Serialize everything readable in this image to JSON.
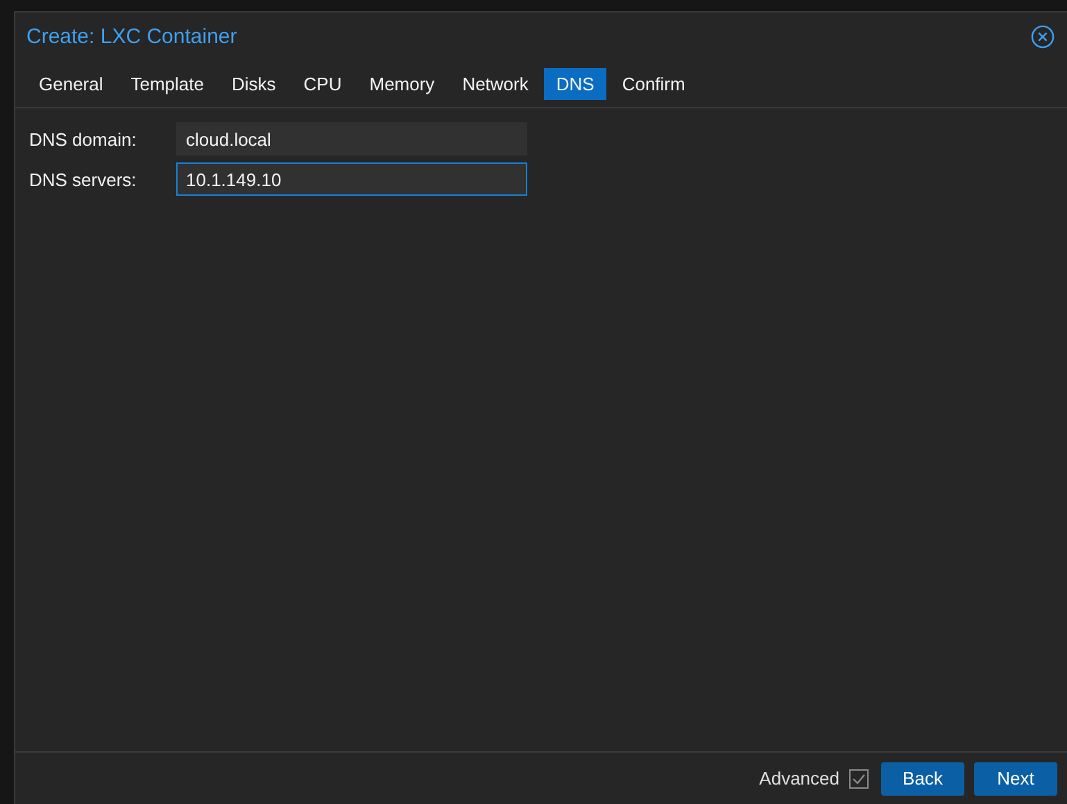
{
  "window": {
    "title": "Create: LXC Container"
  },
  "tabs": [
    {
      "label": "General",
      "selected": false
    },
    {
      "label": "Template",
      "selected": false
    },
    {
      "label": "Disks",
      "selected": false
    },
    {
      "label": "CPU",
      "selected": false
    },
    {
      "label": "Memory",
      "selected": false
    },
    {
      "label": "Network",
      "selected": false
    },
    {
      "label": "DNS",
      "selected": true
    },
    {
      "label": "Confirm",
      "selected": false
    }
  ],
  "fields": [
    {
      "label": "DNS domain:",
      "value": "cloud.local",
      "focused": false
    },
    {
      "label": "DNS servers:",
      "value": "10.1.149.10",
      "focused": true
    }
  ],
  "footer": {
    "advanced": {
      "label": "Advanced",
      "checked": true
    },
    "buttons": [
      "Back",
      "Next"
    ]
  }
}
